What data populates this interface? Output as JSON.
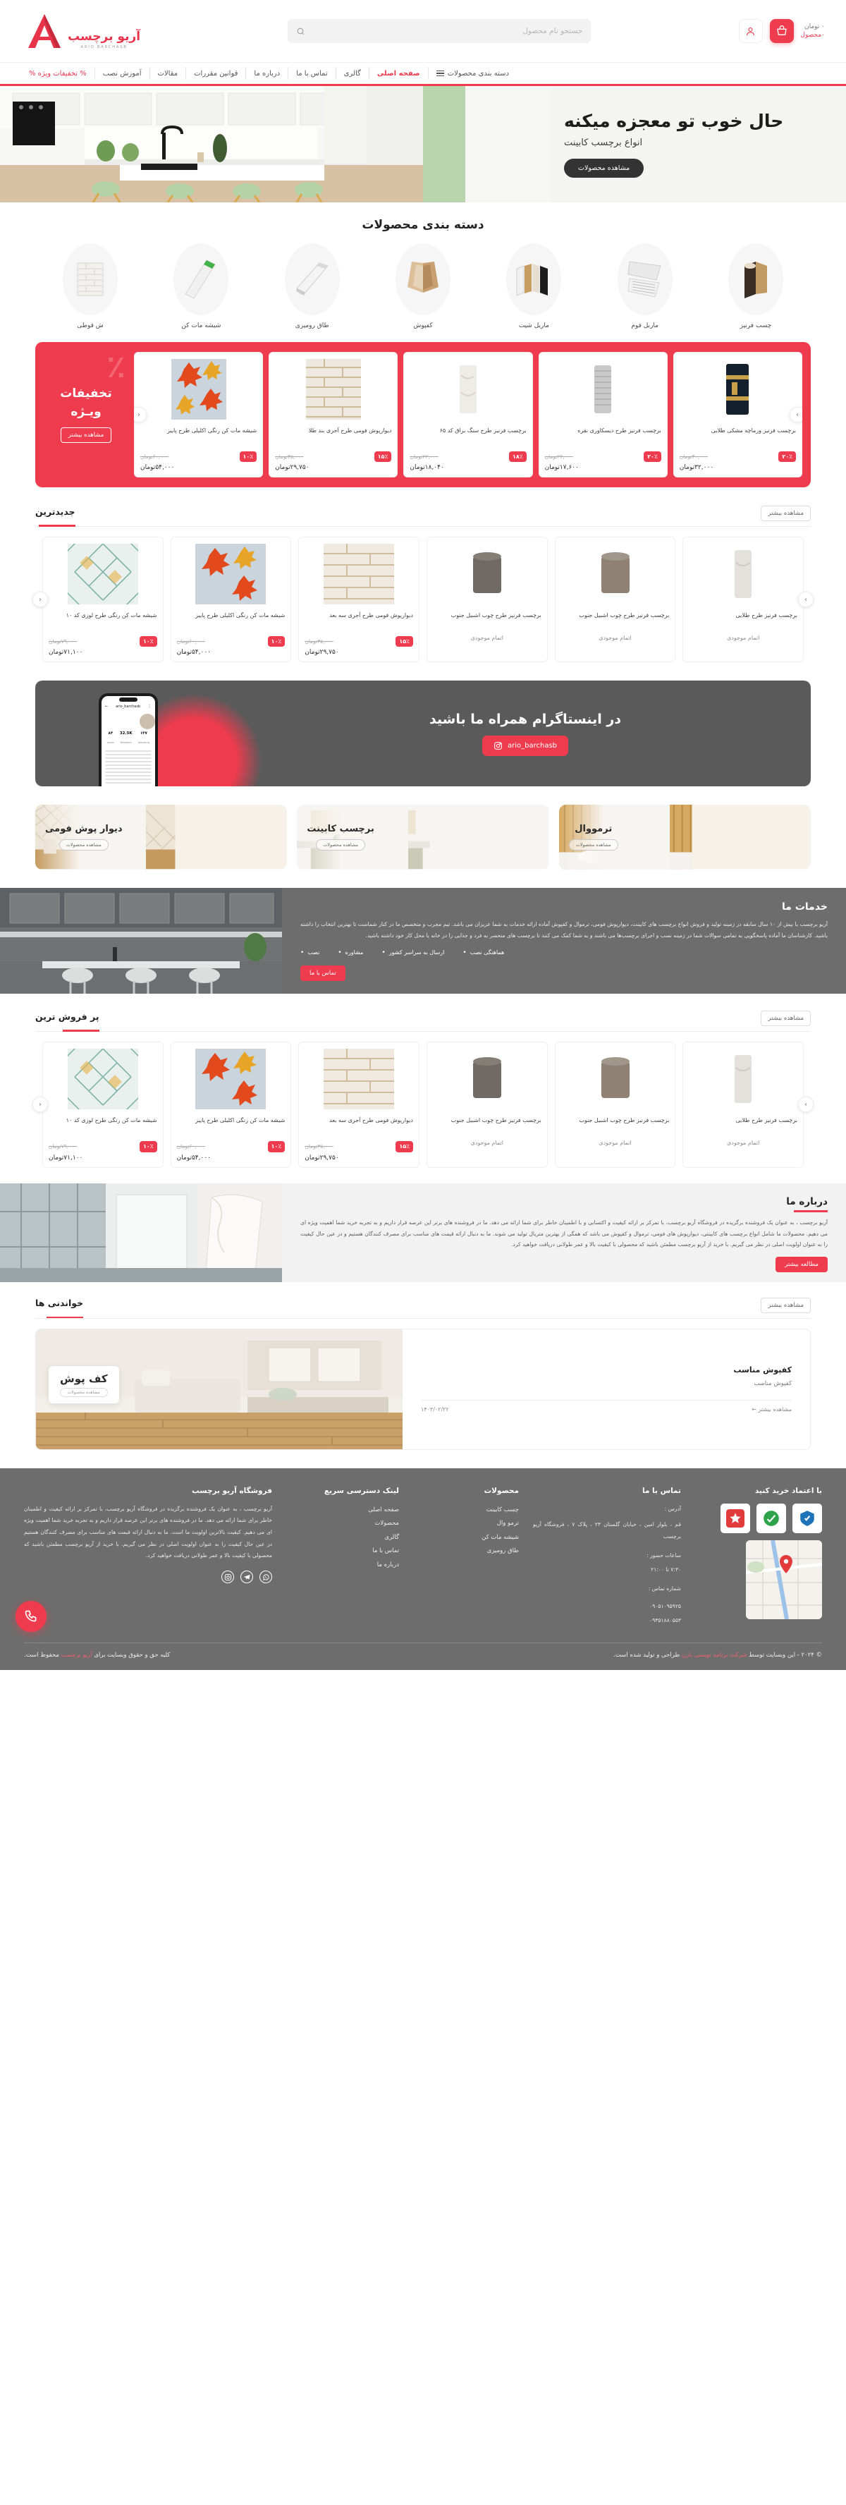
{
  "brand": {
    "name_fa": "آریو برچسب",
    "name_en": "ARIO BARCHASB"
  },
  "header": {
    "search_placeholder": "جستجو نام محصول",
    "search_value": "",
    "search_icon": "search-icon",
    "account_icon": "user-icon",
    "cart_icon": "basket-icon",
    "cart_total": "۰ تومان",
    "cart_count": "۰محصول"
  },
  "nav": {
    "items": [
      {
        "label": "دسته بندی محصولات",
        "active": false,
        "promo": false,
        "icon": "hamburger-icon"
      },
      {
        "label": "صفحه اصلی",
        "active": true,
        "promo": false
      },
      {
        "label": "گالری",
        "active": false,
        "promo": false
      },
      {
        "label": "تماس با ما",
        "active": false,
        "promo": false
      },
      {
        "label": "درباره ما",
        "active": false,
        "promo": false
      },
      {
        "label": "قوانین مقررات",
        "active": false,
        "promo": false
      },
      {
        "label": "مقالات",
        "active": false,
        "promo": false
      },
      {
        "label": "آموزش نصب",
        "active": false,
        "promo": false
      },
      {
        "label": "% تخفیفات ویژه %",
        "active": false,
        "promo": true
      }
    ]
  },
  "hero": {
    "title": "حال خوب تو معجزه میکنه",
    "subtitle": "انواع برچسب کابینت",
    "cta": "مشاهده محصولات"
  },
  "categories": {
    "title": "دسته بندی محصولات",
    "items": [
      {
        "label": "چسب فرنیز"
      },
      {
        "label": "ماربل فوم"
      },
      {
        "label": "ماربل شیت"
      },
      {
        "label": "کفپوش"
      },
      {
        "label": "طاق رومیزی"
      },
      {
        "label": "شیشه مات کن"
      },
      {
        "label": "ش قوطی"
      }
    ]
  },
  "promo_band": {
    "title_line1": "تخفیفات",
    "title_line2": "ویـژه",
    "percent_glyph": "٪",
    "more": "مشاهده بیشتر",
    "products": [
      {
        "name": "برچسب فرنیز ورماچه مشکی طلایی",
        "discount": "۲۰٪",
        "old_price": "۴۰,۰۰۰تومان",
        "new_price": "۳۲,۰۰۰تومان"
      },
      {
        "name": "برچسب فرنیز طرح دیسکاوری نقره",
        "discount": "۲۰٪",
        "old_price": "۲۲,۰۰۰تومان",
        "new_price": "۱۷,۶۰۰تومان"
      },
      {
        "name": "برچسب فرنیز طرح سنگ براق کد ۶۵",
        "discount": "۱۸٪",
        "old_price": "۲۲,۰۰۰تومان",
        "new_price": "۱۸,۰۴۰تومان"
      },
      {
        "name": "دیوارپوش فومی طرح آجری بند طلا",
        "discount": "۱۵٪",
        "old_price": "۳۵,۰۰۰تومان",
        "new_price": "۲۹,۷۵۰تومان"
      },
      {
        "name": "شیشه مات کن رنگی اکلیلی طرح پاییز",
        "discount": "۱۰٪",
        "old_price": "۶۰,۰۰۰تومان",
        "new_price": "۵۴,۰۰۰تومان"
      }
    ]
  },
  "newest": {
    "title": "جدیدترین",
    "more": "مشاهده بیشتر",
    "products": [
      {
        "name": "برچسب فرنیز طرح طلایی",
        "discount": "",
        "old_price": "",
        "new_price": "",
        "status": "اتمام موجودی"
      },
      {
        "name": "برچسب فرنیز طرح چوب اشبیل جنوب",
        "discount": "",
        "old_price": "",
        "new_price": "",
        "status": "اتمام موجودی"
      },
      {
        "name": "برچسب فرنیز طرح چوب اشبیل جنوب",
        "discount": "",
        "old_price": "",
        "new_price": "",
        "status": "اتمام موجودی"
      },
      {
        "name": "دیوارپوش فومی طرح آجری سه بعد",
        "discount": "۱۵٪",
        "old_price": "۳۵,۰۰۰تومان",
        "new_price": "۲۹,۷۵۰تومان",
        "status": ""
      },
      {
        "name": "شیشه مات کن رنگی اکلیلی طرح پاییز",
        "discount": "۱۰٪",
        "old_price": "۶۰,۰۰۰تومان",
        "new_price": "۵۴,۰۰۰تومان",
        "status": ""
      },
      {
        "name": "شیشه مات کن رنگی طرح لوزی کد ۱۰",
        "discount": "۱۰٪",
        "old_price": "۷۹,۰۰۰تومان",
        "new_price": "۷۱,۱۰۰تومان",
        "status": ""
      }
    ]
  },
  "instagram": {
    "title": "در اینستاگرام همراه ما باشید",
    "handle": "ario_barchasb",
    "icon": "instagram-icon",
    "phone": {
      "username": "ario_barchasb",
      "posts_count": "۸۴",
      "posts_label": "posts",
      "followers_count": "32.5K",
      "followers_label": "followers",
      "following_count": "۱۴۷",
      "following_label": "following"
    }
  },
  "feature_cards": [
    {
      "title": "دیوار پوش فومی",
      "cta": "مشاهده محصولات"
    },
    {
      "title": "برچسب کابینت",
      "cta": "مشاهده محصولات"
    },
    {
      "title": "ترمووال",
      "cta": "مشاهده محصولات"
    }
  ],
  "services": {
    "title": "خدمات ما",
    "body": "آریو برچسب با بیش از ۱۰ سال سابقه در زمینه تولید و فروش انواع برچسب های کابینت، دیوارپوش فومی، ترموال و کفپوش آماده ارائه خدمات به شما عزیزان می باشد. تیم مجرب و متخصص ما در کنار شماست تا بهترین انتخاب را داشته باشید. کارشناسان ما آماده پاسخگویی به تمامی سوالات شما در زمینه نصب و اجرای برچسب‌ها می باشند و به شما کمک می کنند تا برچسب های منحصر به فرد و جذابی را در خانه یا محل کار خود داشته باشید.",
    "tags": [
      "نصب",
      "مشاوره",
      "ارسال به سراسر کشور",
      "هماهنگی نصب"
    ],
    "cta": "تماس با ما"
  },
  "bestseller": {
    "title": "پر فروش ترین",
    "more": "مشاهده بیشتر",
    "products": [
      {
        "name": "برچسب فرنیز طرح طلایی",
        "discount": "",
        "old_price": "",
        "new_price": "",
        "status": "اتمام موجودی"
      },
      {
        "name": "برچسب فرنیز طرح چوب اشبیل جنوب",
        "discount": "",
        "old_price": "",
        "new_price": "",
        "status": "اتمام موجودی"
      },
      {
        "name": "برچسب فرنیز طرح چوب اشبیل جنوب",
        "discount": "",
        "old_price": "",
        "new_price": "",
        "status": "اتمام موجودی"
      },
      {
        "name": "دیوارپوش فومی طرح آجری سه بعد",
        "discount": "۱۵٪",
        "old_price": "۳۵,۰۰۰تومان",
        "new_price": "۲۹,۷۵۰تومان",
        "status": ""
      },
      {
        "name": "شیشه مات کن رنگی اکلیلی طرح پاییز",
        "discount": "۱۰٪",
        "old_price": "۶۰,۰۰۰تومان",
        "new_price": "۵۴,۰۰۰تومان",
        "status": ""
      },
      {
        "name": "شیشه مات کن رنگی طرح لوزی کد ۱۰",
        "discount": "۱۰٪",
        "old_price": "۷۹,۰۰۰تومان",
        "new_price": "۷۱,۱۰۰تومان",
        "status": ""
      }
    ]
  },
  "about": {
    "title": "درباره ما",
    "body": "آریو برچسب ، به عنوان یک فروشنده برگزیده در فروشگاه آریو برچسب، با تمرکز بر ارائه کیفیت و اکتسابی و با اطمینان خاطر برای شما ارائه می دهد. ما در فروشنده های برتر این عرصه قرار داریم و به تجربه خرید شما اهمیت ویژه ای می دهیم. محصولات ما شامل انواع برچسب های کابینتی، دیوارپوش های فومی، ترموال و کفپوش می باشد که همگی از بهترین متریال تولید می شوند. ما به دنبال ارائه قیمت های مناسب برای مصرف کنندگان هستیم و در عین حال کیفیت را به عنوان اولویت اصلی در نظر می گیریم. با خرید از آریو برچسب مطمئن باشید که محصولی با کیفیت بالا و عمر طولانی دریافت خواهید کرد.",
    "cta": "مطالعه بیشتر"
  },
  "blog": {
    "title": "خواندنی ها",
    "more": "مشاهده بیشتر",
    "card": {
      "badge_title": "کف پوش",
      "badge_sub": "مشاهده محصولات",
      "heading": "کفپوش مناسب",
      "excerpt": "کفپوش مناسب",
      "date": "۱۴۰۳/۰۲/۲۲",
      "read_more": "مشاهده بیشتر ←"
    }
  },
  "footer": {
    "about": {
      "title": "فروشگاه آریو برچسب",
      "body": "آریو برچسب ، به عنوان یک فروشنده برگزیده در فروشگاه آریو برچسب، با تمرکز بر ارائه کیفیت و اطمینان خاطر برای شما ارائه می دهد. ما در فروشنده های برتر این عرصه قرار داریم و به تجربه خرید شما اهمیت ویژه ای می دهیم. کیفیت بالاترین اولویت ما است. ما به دنبال ارائه قیمت های مناسب برای مصرف کنندگان هستیم در عین حال کیفیت را به عنوان اولویت اصلی در نظر می گیریم. با خرید از آریو برچسب مطمئن باشید که محصولی با کیفیت بالا و عمر طولانی دریافت خواهید کرد."
    },
    "quick_links": {
      "title": "لینک دسترسی سریع",
      "items": [
        "صفحه اصلی",
        "محصولات",
        "گالری",
        "تماس با ما",
        "درباره ما"
      ]
    },
    "products": {
      "title": "محصولات",
      "items": [
        "چسب کابینت",
        "ترمو وال",
        "شیشه مات کن",
        "طاق رومیزی"
      ]
    },
    "contact": {
      "title": "تماس با ما",
      "address_label": "آدرس :",
      "address": "قم ، بلوار امین ، خیابان گلستان ۲۳ ، پلاک ۷ ، فروشگاه آریو برچسب",
      "hours_label": "ساعات حضور :",
      "hours": "۷:۳۰ تا ۲۱:۰۰",
      "phone_label": "شماره تماس :",
      "phones": [
        "۰۹۰۵۱۰۹۵۹۲۵",
        "۰۹۳۵۱۸۸۰۵۵۳"
      ]
    },
    "trust": {
      "title": "با اعتماد خرید کنید"
    },
    "socials": [
      {
        "name": "whatsapp-icon",
        "glyph": "✆"
      },
      {
        "name": "telegram-icon",
        "glyph": "➤"
      },
      {
        "name": "instagram-icon",
        "glyph": "◉"
      }
    ],
    "bottom_left": "© ۲۰۲۴ - این وبسایت توسط شرکت برنامه نویسی بارن طراحی و تولید شده است.",
    "bottom_left_plain_1": "© ۲۰۲۴ - این وبسایت توسط ",
    "bottom_left_link": "شرکت برنامه نویسی بارن",
    "bottom_left_plain_2": " طراحی و تولید شده است.",
    "bottom_right_plain_1": "کلیه حق و حقوق وبسایت برای ",
    "bottom_right_link": "آریو برچسب",
    "bottom_right_plain_2": " محفوظ است.",
    "fab_icon": "phone-call-icon"
  },
  "colors": {
    "accent": "#ef3b4e",
    "dark_panel": "#6d6d6d",
    "hero_bg": "#f4f4f2",
    "text": "#3a3a3a"
  }
}
